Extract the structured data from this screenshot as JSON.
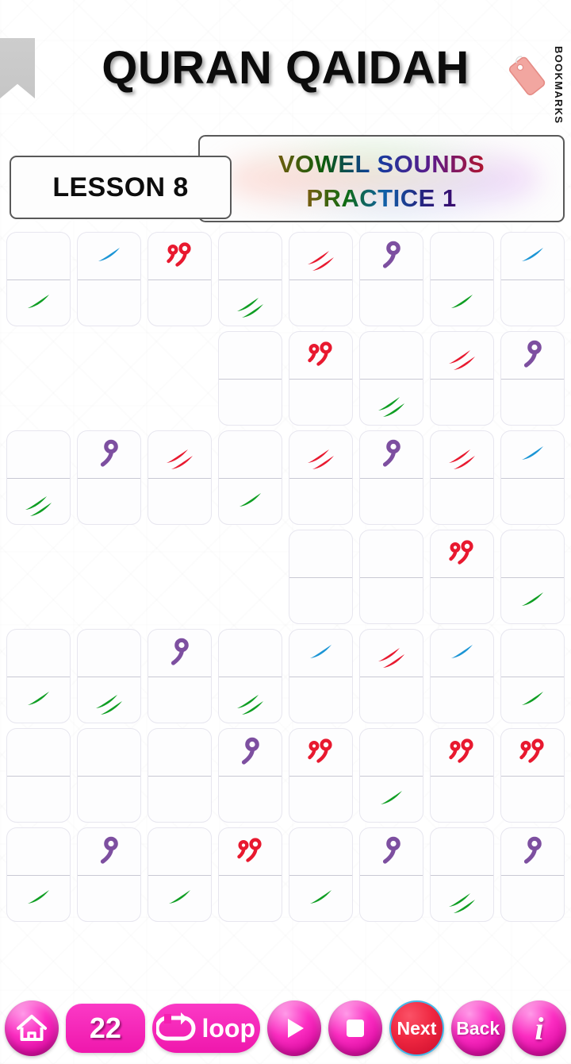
{
  "header": {
    "title": "QURAN QAIDAH",
    "bookmarks_label": "BOOKMARKS",
    "bookmark_tab_icon": "bookmark-ribbon-icon",
    "bookmarks_icon": "price-tag-icon"
  },
  "lesson": {
    "label": "LESSON 8",
    "topic_line_1": "VOWEL SOUNDS",
    "topic_line_2": "PRACTICE 1"
  },
  "colors": {
    "accent_pink": "#f218ae",
    "next_red": "#e0203a",
    "next_outline_blue": "#45b7e8",
    "mark_blue": "#1b95d5",
    "mark_green": "#0f9e23",
    "mark_red": "#e8192f",
    "mark_purple": "#7d4fa0",
    "cell_border": "#e7e6ef",
    "card_border": "#595959",
    "title_black": "#0c0c0c"
  },
  "mark_legend": {
    "fatha_blue": "single-slash-blue",
    "kasra_green": "single-slash-green",
    "kasratan_green": "double-slash-green",
    "fathatan_red": "double-slash-red",
    "damma_purple": "damma-purple",
    "dammatan_red": "dammatan-red",
    "empty": "none"
  },
  "grid": {
    "columns": 8,
    "rows": [
      {
        "offset": 0,
        "cells": [
          {
            "top": "none",
            "bottom": "kasra_green"
          },
          {
            "top": "fatha_blue",
            "bottom": "none"
          },
          {
            "top": "dammatan_red",
            "bottom": "none"
          },
          {
            "top": "none",
            "bottom": "kasratan_green"
          },
          {
            "top": "fathatan_red",
            "bottom": "none"
          },
          {
            "top": "damma_purple",
            "bottom": "none"
          },
          {
            "top": "none",
            "bottom": "kasra_green"
          },
          {
            "top": "fatha_blue",
            "bottom": "none"
          }
        ]
      },
      {
        "offset": 3,
        "cells": [
          {
            "top": "none",
            "bottom": "none"
          },
          {
            "top": "dammatan_red",
            "bottom": "none"
          },
          {
            "top": "none",
            "bottom": "kasratan_green"
          },
          {
            "top": "fathatan_red",
            "bottom": "none"
          },
          {
            "top": "damma_purple",
            "bottom": "none"
          }
        ]
      },
      {
        "offset": 0,
        "cells": [
          {
            "top": "none",
            "bottom": "kasratan_green"
          },
          {
            "top": "damma_purple",
            "bottom": "none"
          },
          {
            "top": "fathatan_red",
            "bottom": "none"
          },
          {
            "top": "none",
            "bottom": "kasra_green"
          },
          {
            "top": "fathatan_red",
            "bottom": "none"
          },
          {
            "top": "damma_purple",
            "bottom": "none"
          },
          {
            "top": "fathatan_red",
            "bottom": "none"
          },
          {
            "top": "fatha_blue",
            "bottom": "none"
          }
        ]
      },
      {
        "offset": 4,
        "cells": [
          {
            "top": "none",
            "bottom": "none"
          },
          {
            "top": "none",
            "bottom": "none"
          },
          {
            "top": "dammatan_red",
            "bottom": "none"
          },
          {
            "top": "none",
            "bottom": "kasra_green"
          }
        ]
      },
      {
        "offset": 0,
        "cells": [
          {
            "top": "none",
            "bottom": "kasra_green"
          },
          {
            "top": "none",
            "bottom": "kasratan_green"
          },
          {
            "top": "damma_purple",
            "bottom": "none"
          },
          {
            "top": "none",
            "bottom": "kasratan_green"
          },
          {
            "top": "fatha_blue",
            "bottom": "none"
          },
          {
            "top": "fathatan_red",
            "bottom": "none"
          },
          {
            "top": "fatha_blue",
            "bottom": "none"
          },
          {
            "top": "none",
            "bottom": "kasra_green"
          }
        ]
      },
      {
        "offset": 0,
        "cells": [
          {
            "top": "none",
            "bottom": "none"
          },
          {
            "top": "none",
            "bottom": "none"
          },
          {
            "top": "none",
            "bottom": "none"
          },
          {
            "top": "damma_purple",
            "bottom": "none"
          },
          {
            "top": "dammatan_red",
            "bottom": "none"
          },
          {
            "top": "none",
            "bottom": "kasra_green"
          },
          {
            "top": "dammatan_red",
            "bottom": "none"
          },
          {
            "top": "dammatan_red",
            "bottom": "none"
          }
        ]
      },
      {
        "offset": 0,
        "cells": [
          {
            "top": "none",
            "bottom": "kasra_green"
          },
          {
            "top": "damma_purple",
            "bottom": "none"
          },
          {
            "top": "none",
            "bottom": "kasra_green"
          },
          {
            "top": "dammatan_red",
            "bottom": "none"
          },
          {
            "top": "none",
            "bottom": "kasra_green"
          },
          {
            "top": "damma_purple",
            "bottom": "none"
          },
          {
            "top": "none",
            "bottom": "kasratan_green"
          },
          {
            "top": "damma_purple",
            "bottom": "none"
          }
        ]
      }
    ]
  },
  "toolbar": {
    "home_icon": "home-icon",
    "counter_value": "22",
    "loop_icon": "repeat-loop-icon",
    "loop_label": "loop",
    "play_icon": "play-icon",
    "stop_icon": "stop-icon",
    "next_label": "Next",
    "back_label": "Back",
    "info_glyph": "i",
    "info_icon": "info-icon"
  }
}
